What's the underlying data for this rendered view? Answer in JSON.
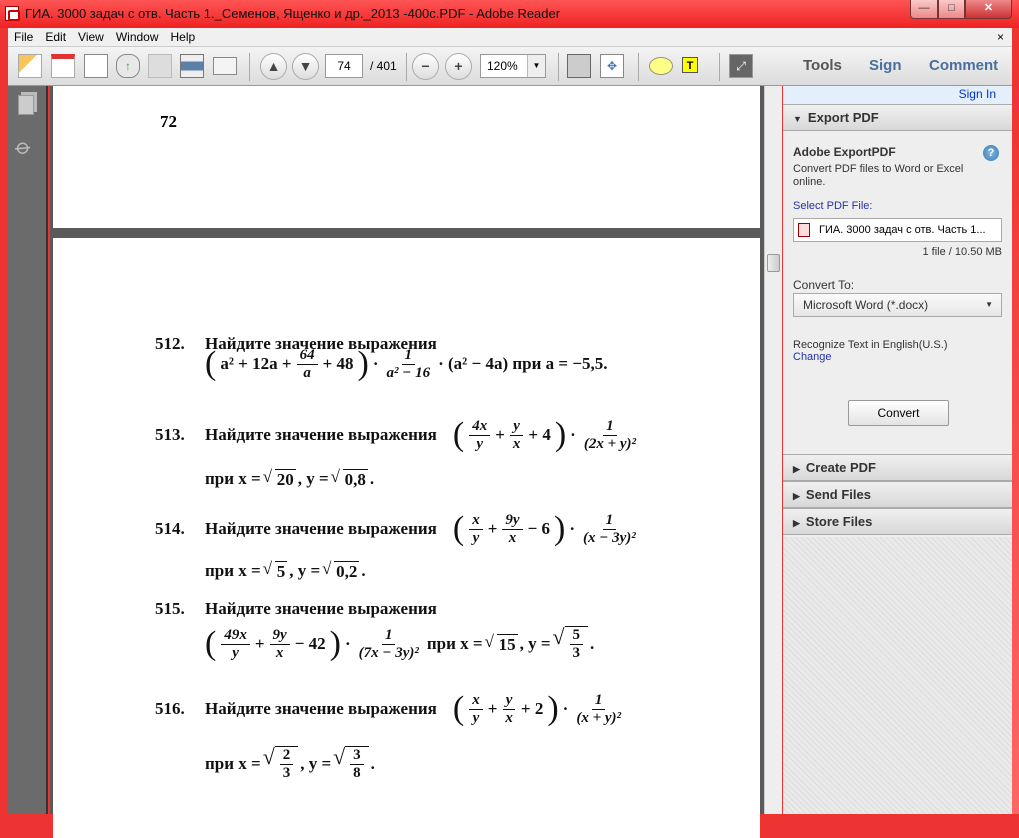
{
  "window": {
    "title": "ГИА. 3000 задач с отв. Часть 1._Семенов, Ященко и др._2013 -400с.PDF - Adobe Reader",
    "min": "—",
    "max": "□",
    "close": "✕"
  },
  "menu": [
    "File",
    "Edit",
    "View",
    "Window",
    "Help"
  ],
  "menu_close": "×",
  "toolbar": {
    "page": "74",
    "total": "/ 401",
    "zoom": "120%",
    "tools": "Tools",
    "sign": "Sign",
    "comment": "Comment"
  },
  "document": {
    "page_number": "72",
    "problems": [
      {
        "num": "512.",
        "text": "Найдите значение выражения",
        "line2": [
          {
            "p": "("
          },
          {
            "t": "a² + 12a +"
          },
          {
            "f": [
              "64",
              "a"
            ]
          },
          {
            "t": "+ 48"
          },
          {
            "p": ")"
          },
          {
            "t": "·"
          },
          {
            "f": [
              "1",
              "a² − 16"
            ]
          },
          {
            "t": "· (a² − 4a)  при  a = −5,5."
          }
        ]
      },
      {
        "num": "513.",
        "text": "Найдите  значение  выражения",
        "line1": [
          {
            "p": "("
          },
          {
            "f": [
              "4x",
              "y"
            ]
          },
          {
            "t": "+"
          },
          {
            "f": [
              "y",
              "x"
            ]
          },
          {
            "t": "+ 4"
          },
          {
            "p": ")"
          },
          {
            "t": "·"
          },
          {
            "f": [
              "1",
              "(2x + y)²"
            ]
          }
        ],
        "line2": [
          {
            "t": "при  x ="
          },
          {
            "s": "20"
          },
          {
            "t": ",  y ="
          },
          {
            "s": "0,8"
          },
          {
            "t": "."
          }
        ]
      },
      {
        "num": "514.",
        "text": "Найдите значение выражения",
        "line1": [
          {
            "p": "("
          },
          {
            "f": [
              "x",
              "y"
            ]
          },
          {
            "t": "+"
          },
          {
            "f": [
              "9y",
              "x"
            ]
          },
          {
            "t": "− 6"
          },
          {
            "p": ")"
          },
          {
            "t": "·"
          },
          {
            "f": [
              "1",
              "(x − 3y)²"
            ]
          }
        ],
        "line2": [
          {
            "t": "при  x ="
          },
          {
            "s": "5"
          },
          {
            "t": ",  y ="
          },
          {
            "s": "0,2"
          },
          {
            "t": "."
          }
        ]
      },
      {
        "num": "515.",
        "text": "Найдите значение выражения",
        "line2": [
          {
            "p": "("
          },
          {
            "f": [
              "49x",
              "y"
            ]
          },
          {
            "t": "+"
          },
          {
            "f": [
              "9y",
              "x"
            ]
          },
          {
            "t": "− 42"
          },
          {
            "p": ")"
          },
          {
            "t": "·"
          },
          {
            "f": [
              "1",
              "(7x − 3y)²"
            ]
          },
          {
            "t": "  при  x ="
          },
          {
            "s": "15"
          },
          {
            "t": ",  y ="
          },
          {
            "sf": [
              "5",
              "3"
            ]
          },
          {
            "t": "."
          }
        ]
      },
      {
        "num": "516.",
        "text": "Найдите значение выражения",
        "line1": [
          {
            "p": "("
          },
          {
            "f": [
              "x",
              "y"
            ]
          },
          {
            "t": "+"
          },
          {
            "f": [
              "y",
              "x"
            ]
          },
          {
            "t": "+ 2"
          },
          {
            "p": ")"
          },
          {
            "t": "·"
          },
          {
            "f": [
              "1",
              "(x + y)²"
            ]
          }
        ],
        "line2": [
          {
            "t": "при  x ="
          },
          {
            "sf": [
              "2",
              "3"
            ]
          },
          {
            "t": ",  y ="
          },
          {
            "sf": [
              "3",
              "8"
            ]
          },
          {
            "t": "."
          }
        ]
      }
    ]
  },
  "panel": {
    "sign_in": "Sign In",
    "export_pdf": "Export PDF",
    "service": "Adobe ExportPDF",
    "help": "?",
    "desc1": "Convert PDF files to Word or Excel",
    "desc2": "online.",
    "select_label": "Select PDF File:",
    "file": "ГИА. 3000 задач с отв. Часть 1...",
    "file_info": "1 file / 10.50 MB",
    "convert_to": "Convert To:",
    "format": "Microsoft Word (*.docx)",
    "recognize": "Recognize Text in English(U.S.)",
    "change": "Change",
    "convert": "Convert",
    "create_pdf": "Create PDF",
    "send_files": "Send Files",
    "store_files": "Store Files"
  }
}
